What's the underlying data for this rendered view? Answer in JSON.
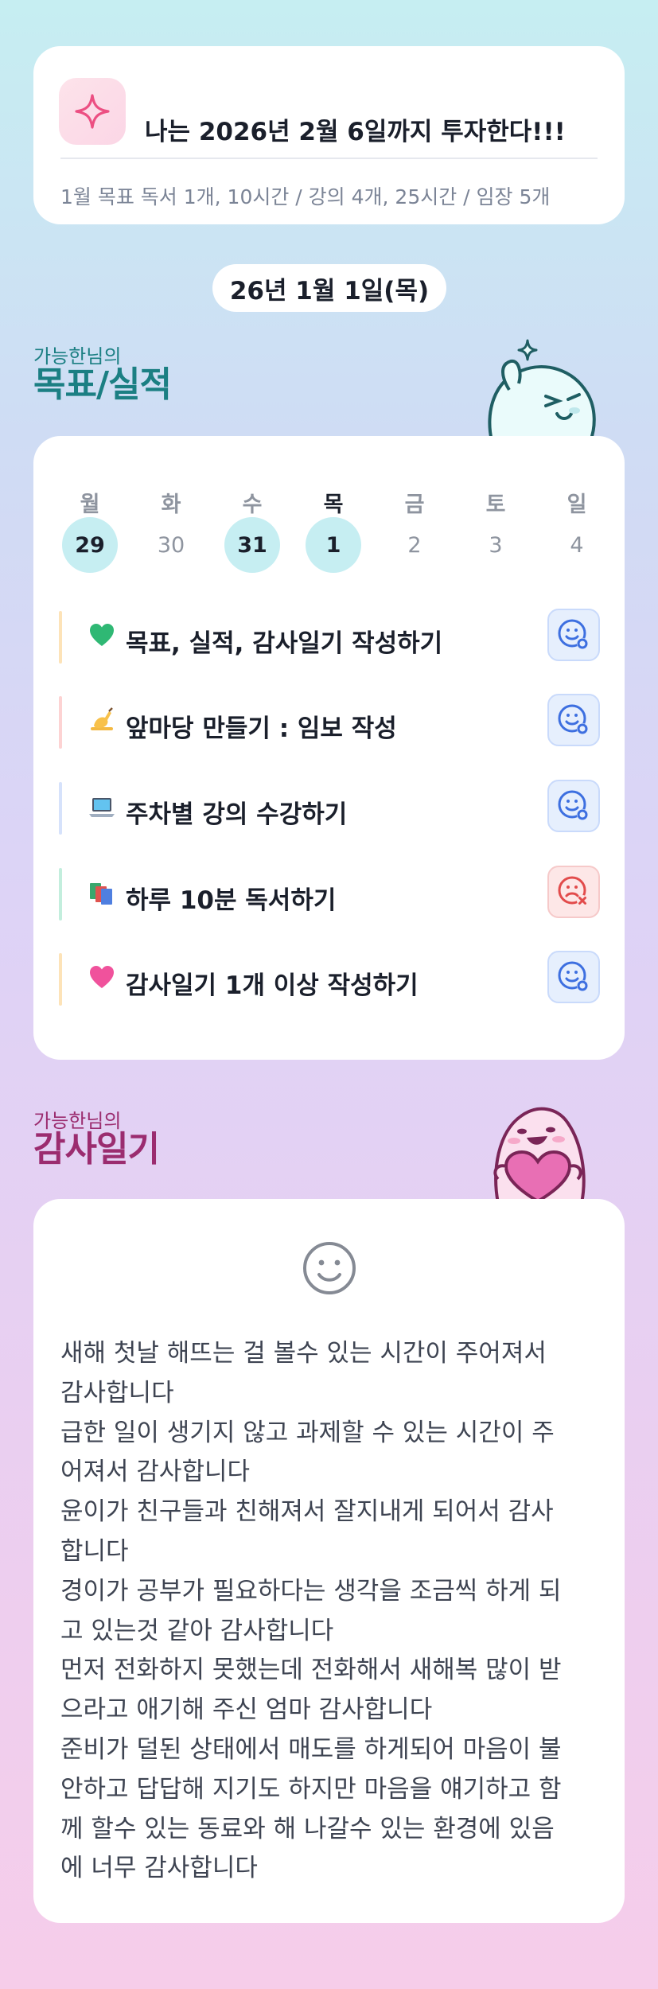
{
  "goal": {
    "icon": "sparkle-icon",
    "title": "나는 2026년 2월 6일까지 투자한다!!!",
    "month_goal": "1월 목표  독서 1개, 10시간 / 강의 4개, 25시간 / 임장 5개"
  },
  "date_pill": "26년 1월 1일(목)",
  "goals_section": {
    "subtitle": "가능한님의",
    "title": "목표/실적"
  },
  "calendar": {
    "weekdays": [
      "월",
      "화",
      "수",
      "목",
      "금",
      "토",
      "일"
    ],
    "days": [
      "29",
      "30",
      "31",
      "1",
      "2",
      "3",
      "4"
    ],
    "highlighted_days": [
      "29",
      "31",
      "1"
    ],
    "today_index": 3
  },
  "tasks": [
    {
      "emoji": "green-heart-icon",
      "label": "목표, 실적, 감사일기 작성하기",
      "bar_color": "#fde3b8",
      "status": "done"
    },
    {
      "emoji": "writing-hand-icon",
      "label": "앞마당 만들기 : 임보 작성",
      "bar_color": "#fdd3d3",
      "status": "done"
    },
    {
      "emoji": "laptop-icon",
      "label": "주차별 강의 수강하기",
      "bar_color": "#d6e2fb",
      "status": "done"
    },
    {
      "emoji": "books-icon",
      "label": "하루 10분 독서하기",
      "bar_color": "#c3eedd",
      "status": "not-done"
    },
    {
      "emoji": "pink-heart-icon",
      "label": "감사일기 1개 이상 작성하기",
      "bar_color": "#fde3b8",
      "status": "done"
    }
  ],
  "diary_section": {
    "subtitle": "가능한님의",
    "title": "감사일기"
  },
  "diary": {
    "face_icon": "smile-face-icon",
    "text": "새해 첫날 해뜨는 걸 볼수 있는 시간이 주어져서\n감사합니다\n급한 일이 생기지 않고 과제할 수 있는 시간이 주\n어져서 감사합니다\n윤이가 친구들과 친해져서 잘지내게 되어서 감사\n합니다\n경이가 공부가 필요하다는 생각을 조금씩 하게 되\n고 있는것 같아 감사합니다\n먼저 전화하지 못했는데 전화해서 새해복 많이 받\n으라고 애기해 주신 엄마 감사합니다\n준비가 덜된 상태에서 매도를 하게되어 마음이 불\n안하고 답답해 지기도 하지만 마음을 얘기하고 함\n께 할수 있는 동료와 해 나갈수 있는 환경에 있음\n에 너무 감사합니다"
  },
  "colors": {
    "teal": "#1b7f83",
    "plum": "#9b2c6f",
    "highlight": "#c6eef2",
    "status_good": "#3d6fe0",
    "status_bad": "#e24b4b"
  }
}
